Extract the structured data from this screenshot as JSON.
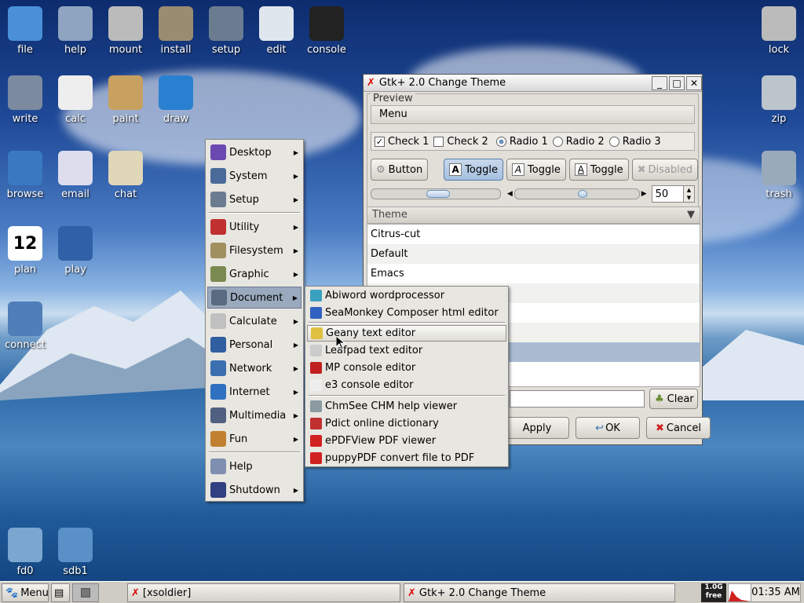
{
  "desktop": {
    "icons_left": [
      {
        "label": "file",
        "icon": "home-folder-icon",
        "color": "#4a90d8"
      },
      {
        "label": "help",
        "icon": "info-icon",
        "color": "#8fa4c0"
      },
      {
        "label": "mount",
        "icon": "hard-drive-icon",
        "color": "#bbb"
      },
      {
        "label": "install",
        "icon": "package-box-icon",
        "color": "#9a8c70"
      },
      {
        "label": "setup",
        "icon": "tools-monitor-icon",
        "color": "#6c7c90"
      },
      {
        "label": "edit",
        "icon": "paper-pen-icon",
        "color": "#dfe6ee"
      },
      {
        "label": "console",
        "icon": "terminal-icon",
        "color": "#222"
      },
      {
        "label": "write",
        "icon": "writing-tools-icon",
        "color": "#7c8aa0"
      },
      {
        "label": "calc",
        "icon": "calculator-icon",
        "color": "#eee"
      },
      {
        "label": "paint",
        "icon": "palette-icon",
        "color": "#c8a060"
      },
      {
        "label": "draw",
        "icon": "draw-shapes-icon",
        "color": "#2a80d0"
      },
      {
        "label": "browse",
        "icon": "globe-icon",
        "color": "#3a78c0"
      },
      {
        "label": "email",
        "icon": "email-globe-icon",
        "color": "#dde"
      },
      {
        "label": "chat",
        "icon": "chat-bubble-icon",
        "color": "#e0d6b8"
      },
      {
        "label": "plan",
        "icon": "calendar-icon",
        "color": "#2f5fa0"
      },
      {
        "label": "play",
        "icon": "film-strip-icon",
        "color": "#3060a8"
      },
      {
        "label": "connect",
        "icon": "connect-globe-icon",
        "color": "#4f7eb8"
      },
      {
        "label": "fd0",
        "icon": "floppy-disk-icon",
        "color": "#7aa6d0"
      },
      {
        "label": "sdb1",
        "icon": "usb-drive-icon",
        "color": "#5a90c8"
      }
    ],
    "icons_right": [
      {
        "label": "lock",
        "icon": "padlock-icon",
        "color": "#bbb"
      },
      {
        "label": "zip",
        "icon": "zip-archive-icon",
        "color": "#bcc4cc"
      },
      {
        "label": "trash",
        "icon": "trash-can-icon",
        "color": "#9ab"
      }
    ],
    "calendar_day": "12"
  },
  "window": {
    "title": "Gtk+ 2.0 Change Theme",
    "preview_label": "Preview",
    "menu_label": "Menu",
    "check1": "Check 1",
    "check2": "Check 2",
    "radio1": "Radio 1",
    "radio2": "Radio 2",
    "radio3": "Radio 3",
    "button_label": "Button",
    "toggle_labels": [
      "Toggle",
      "Toggle",
      "Toggle"
    ],
    "disabled_label": "Disabled",
    "spin_value": "50",
    "theme_header": "Theme",
    "themes": [
      "Citrus-cut",
      "Default",
      "Emacs",
      "",
      "",
      "",
      "",
      ""
    ],
    "clear_label": "Clear",
    "apply_label": "Apply",
    "ok_label": "OK",
    "cancel_label": "Cancel"
  },
  "main_menu": {
    "items": [
      {
        "label": "Desktop",
        "color": "#6a4ab0"
      },
      {
        "label": "System",
        "color": "#4a6a9a"
      },
      {
        "label": "Setup",
        "color": "#6c7c90"
      },
      {
        "label": "Utility",
        "color": "#c03030"
      },
      {
        "label": "Filesystem",
        "color": "#a09060"
      },
      {
        "label": "Graphic",
        "color": "#7a8a50"
      },
      {
        "label": "Document",
        "color": "#5a6a80"
      },
      {
        "label": "Calculate",
        "color": "#c0c0c0"
      },
      {
        "label": "Personal",
        "color": "#2f5fa0"
      },
      {
        "label": "Network",
        "color": "#3a70b0"
      },
      {
        "label": "Internet",
        "color": "#3070c0"
      },
      {
        "label": "Multimedia",
        "color": "#506080"
      },
      {
        "label": "Fun",
        "color": "#c08030"
      },
      {
        "label": "Help",
        "color": "#7f8fb0"
      },
      {
        "label": "Shutdown",
        "color": "#304080"
      }
    ]
  },
  "sub_menu": {
    "items": [
      {
        "label": "Abiword wordprocessor",
        "color": "#3aa0c0"
      },
      {
        "label": "SeaMonkey Composer html editor",
        "color": "#3060c0"
      },
      {
        "label": "Geany text editor",
        "color": "#e0c040"
      },
      {
        "label": "Leafpad text editor",
        "color": "#cccccc"
      },
      {
        "label": "MP console editor",
        "color": "#c02020"
      },
      {
        "label": "e3 console editor",
        "color": "#eeeeee"
      },
      {
        "label": "ChmSee CHM help viewer",
        "color": "#8a9aa0"
      },
      {
        "label": "Pdict online dictionary",
        "color": "#c03030"
      },
      {
        "label": "ePDFView PDF viewer",
        "color": "#d02020"
      },
      {
        "label": "puppyPDF convert file to PDF",
        "color": "#d02020"
      }
    ]
  },
  "taskbar": {
    "menu_label": "Menu",
    "task1": "[xsoldier]",
    "task2": "Gtk+ 2.0 Change Theme",
    "free_top": "1.0G",
    "free_bottom": "free",
    "clock": "01:35 AM"
  }
}
